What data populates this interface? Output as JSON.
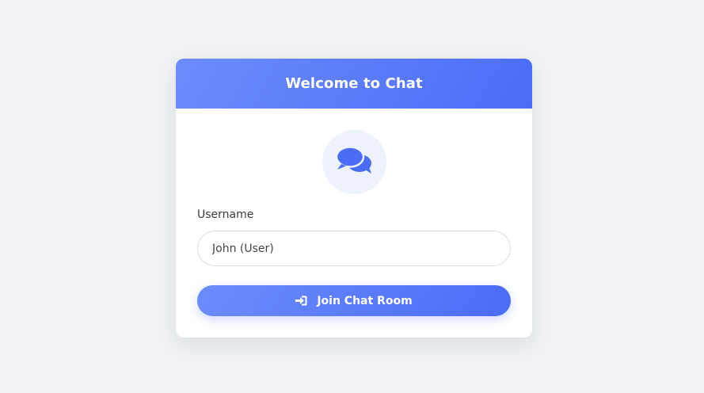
{
  "card": {
    "title": "Welcome to Chat",
    "logo_icon": "chat-bubbles-icon"
  },
  "form": {
    "username_label": "Username",
    "username_value": "John (User)",
    "join_button_label": "Join Chat Room",
    "join_button_icon": "sign-in-icon"
  },
  "colors": {
    "background": "#f0f2f5",
    "accent": "#4a6cf7",
    "accent_light": "#6d8cfb",
    "logo_circle": "#eef2fd"
  }
}
